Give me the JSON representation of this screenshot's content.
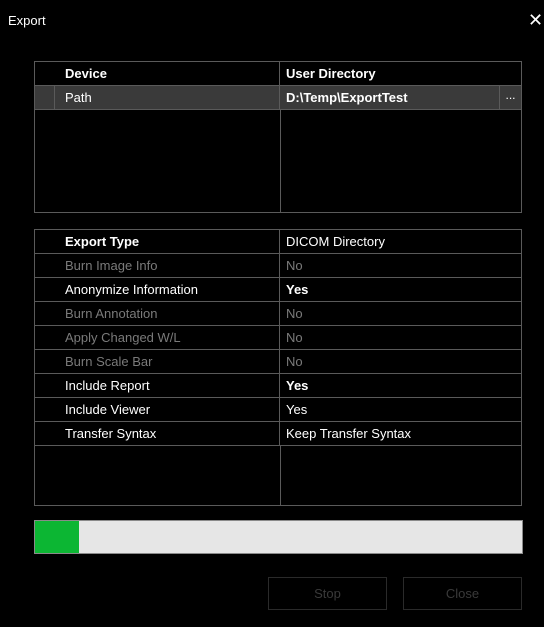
{
  "window": {
    "title": "Export",
    "close_glyph": "✕"
  },
  "device_table": {
    "header": {
      "col1": "Device",
      "col2": "User Directory"
    },
    "rows": [
      {
        "label": "Path",
        "value": "D:\\Temp\\ExportTest",
        "button": "..."
      }
    ]
  },
  "options_table": {
    "rows": [
      {
        "label": "Export Type",
        "value": "DICOM Directory",
        "enabled": true
      },
      {
        "label": "Burn Image Info",
        "value": "No",
        "enabled": false
      },
      {
        "label": "Anonymize Information",
        "value": "Yes",
        "enabled": true
      },
      {
        "label": "Burn Annotation",
        "value": "No",
        "enabled": false
      },
      {
        "label": "Apply Changed W/L",
        "value": "No",
        "enabled": false
      },
      {
        "label": "Burn Scale Bar",
        "value": "No",
        "enabled": false
      },
      {
        "label": "Include Report",
        "value": "Yes",
        "enabled": true
      },
      {
        "label": "Include Viewer",
        "value": "Yes",
        "enabled": true
      },
      {
        "label": "Transfer Syntax",
        "value": "Keep Transfer Syntax",
        "enabled": true
      }
    ]
  },
  "progress": {
    "fraction": 0.09,
    "color": "#0cb633"
  },
  "buttons": {
    "stop": "Stop",
    "close": "Close"
  },
  "colors": {
    "background": "#000000",
    "grid": "#5a5a5a",
    "disabled_text": "#7a7a7a"
  }
}
